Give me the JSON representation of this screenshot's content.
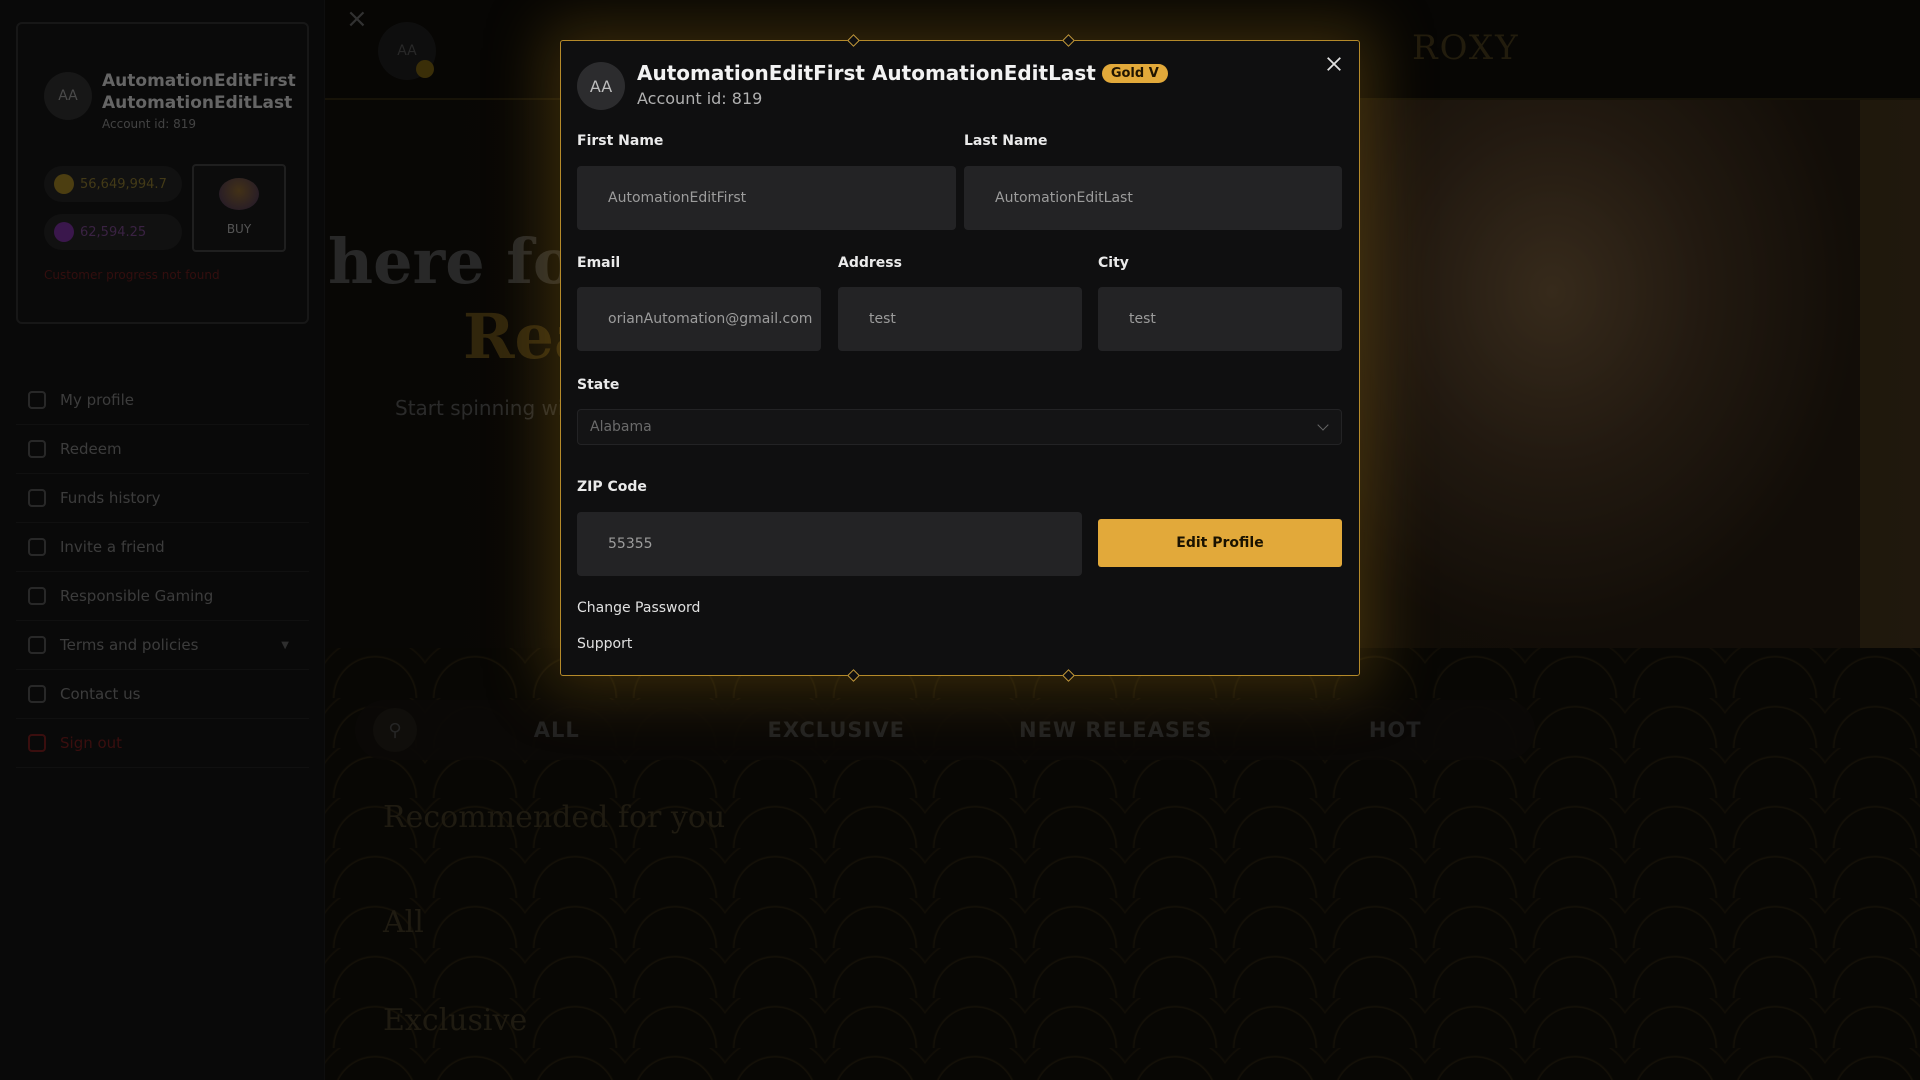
{
  "background": {
    "profile_card": {
      "avatar_initials": "AA",
      "name_line1": "AutomationEditFirst",
      "name_line2": "AutomationEditLast",
      "account_id": "Account id: 819",
      "gold_balance": "56,649,994.7",
      "sweeps_balance": "62,594.25",
      "buy_label": "BUY",
      "error_text": "Customer progress not found"
    },
    "nav": [
      {
        "label": "My profile",
        "icon": "user-icon"
      },
      {
        "label": "Redeem",
        "icon": "wallet-icon"
      },
      {
        "label": "Funds history",
        "icon": "search-history-icon"
      },
      {
        "label": "Invite a friend",
        "icon": "invite-icon"
      },
      {
        "label": "Responsible Gaming",
        "icon": "responsible-gaming-icon"
      },
      {
        "label": "Terms and policies",
        "icon": "document-icon"
      },
      {
        "label": "Contact us",
        "icon": "contact-icon"
      },
      {
        "label": "Sign out",
        "icon": "signout-icon"
      }
    ],
    "top_avatar_initials": "AA",
    "logo_text": "ROXY",
    "hero": {
      "title_line1": "here for",
      "title_line2": "Rea",
      "subtitle": "Start spinning wit"
    },
    "game_tabs": [
      "ALL",
      "EXCLUSIVE",
      "NEW RELEASES",
      "HOT"
    ],
    "sections": [
      "Recommended for you",
      "All",
      "Exclusive"
    ]
  },
  "modal": {
    "avatar_initials": "AA",
    "full_name": "AutomationEditFirst AutomationEditLast",
    "tier_badge": "Gold V",
    "account_id": "Account id: 819",
    "fields": {
      "first_name": {
        "label": "First Name",
        "value": "AutomationEditFirst"
      },
      "last_name": {
        "label": "Last Name",
        "value": "AutomationEditLast"
      },
      "email": {
        "label": "Email",
        "value": "orianAutomation@gmail.com"
      },
      "address": {
        "label": "Address",
        "value": "test"
      },
      "city": {
        "label": "City",
        "value": "test"
      },
      "state": {
        "label": "State",
        "value": "Alabama"
      },
      "zip": {
        "label": "ZIP Code",
        "value": "55355"
      }
    },
    "edit_button": "Edit Profile",
    "change_password": "Change Password",
    "support": "Support"
  },
  "colors": {
    "accent_gold": "#e2a93a",
    "modal_border": "#b58a2a"
  }
}
